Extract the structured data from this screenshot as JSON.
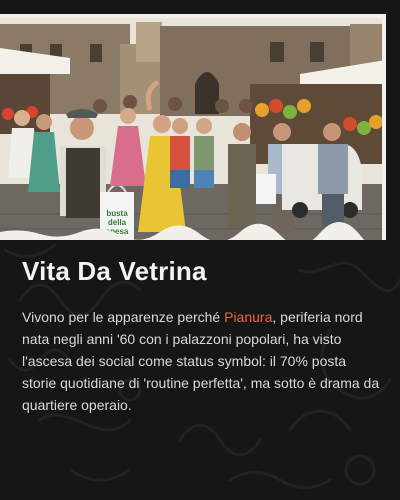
{
  "article": {
    "title": "Vita Da Vetrina",
    "body_before": "Vivono per le apparenze perché ",
    "highlight": "Pianura",
    "body_after": ", periferia nord nata negli anni '60 con i palazzoni popolari, ha visto l'ascesa dei social come status symbol: il 70% posta storie quotidiane di 'routine perfetta', ma sotto è drama da quartiere operaio.",
    "highlight_color": "#e8693a"
  },
  "hero_image": {
    "bag_text_line1": "busta",
    "bag_text_line2": "della",
    "bag_text_line3": "spesa"
  }
}
